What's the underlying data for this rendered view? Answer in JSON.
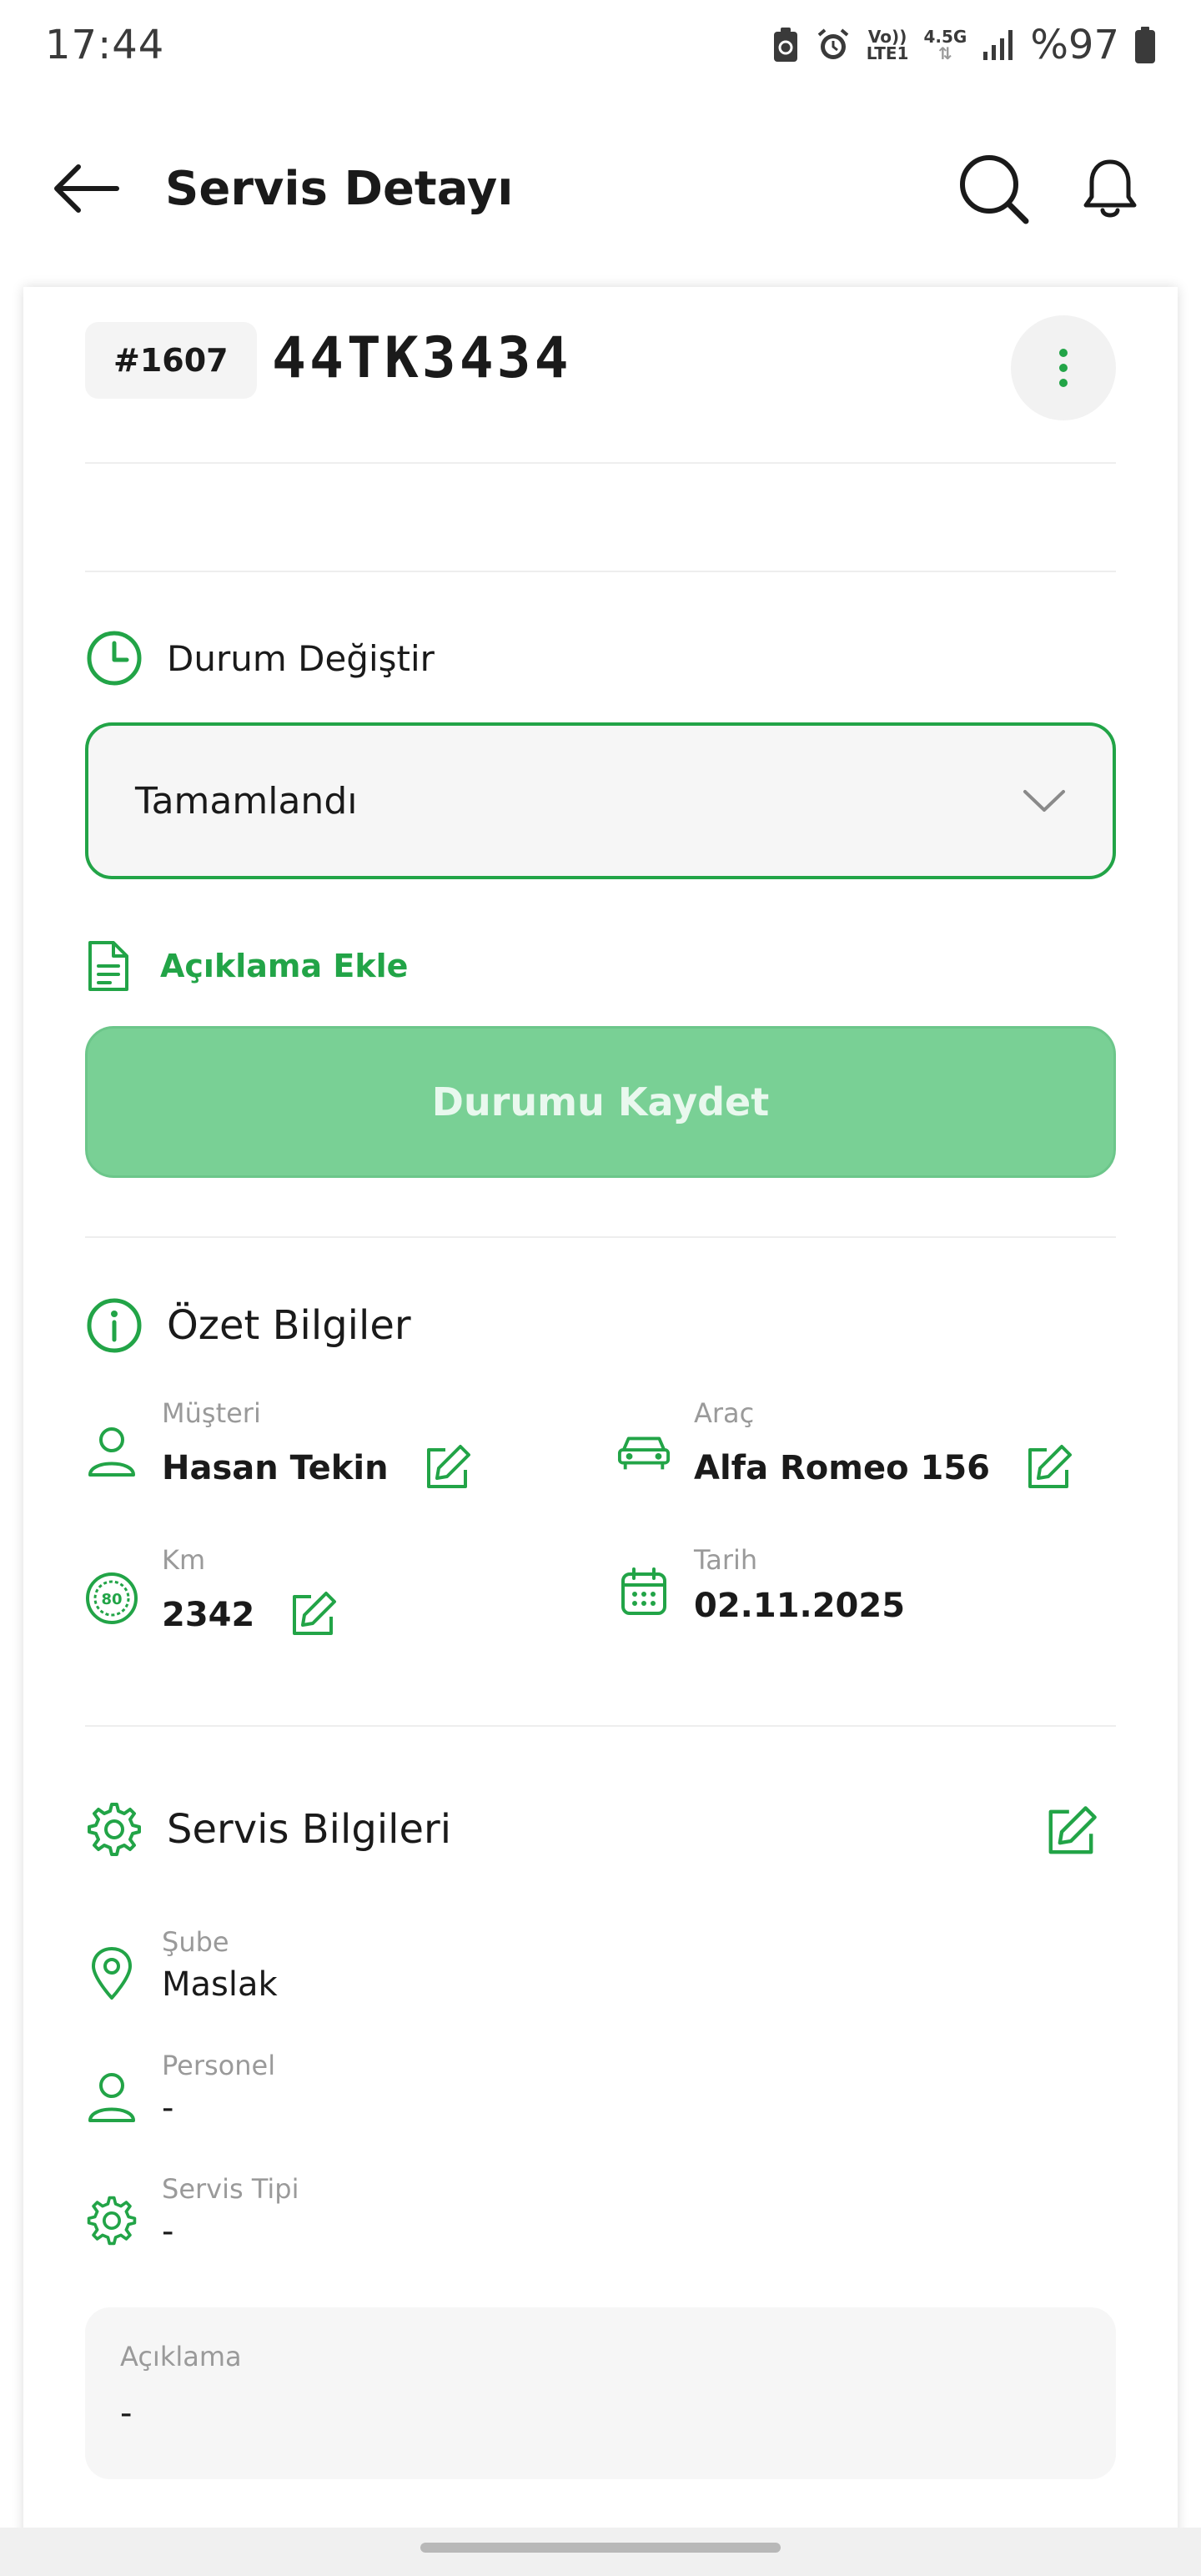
{
  "status_bar": {
    "time": "17:44",
    "volte_top": "Vo))",
    "volte_bottom": "LTE1",
    "network": "4.5G",
    "battery": "%97",
    "icons": [
      "battery-saver-icon",
      "alarm-icon",
      "signal-icon",
      "battery-icon"
    ]
  },
  "app_bar": {
    "title": "Servis Detayı",
    "icons": [
      "back-arrow-icon",
      "search-icon",
      "bell-icon"
    ]
  },
  "header": {
    "id_label": "#1607",
    "plate": "44TK3434"
  },
  "status_section": {
    "title": "Durum Değiştir",
    "selected_value": "Tamamlandı",
    "add_note_label": "Açıklama Ekle",
    "save_label": "Durumu Kaydet"
  },
  "summary": {
    "title": "Özet Bilgiler",
    "customer_label": "Müşteri",
    "customer_value": "Hasan Tekin",
    "vehicle_label": "Araç",
    "vehicle_value": "Alfa Romeo 156",
    "km_label": "Km",
    "km_value": "2342",
    "date_label": "Tarih",
    "date_value": "02.11.2025"
  },
  "service_info": {
    "title": "Servis Bilgileri",
    "branch_label": "Şube",
    "branch_value": "Maslak",
    "staff_label": "Personel",
    "staff_value": "-",
    "type_label": "Servis Tipi",
    "type_value": "-",
    "note_label": "Açıklama",
    "note_value": "-"
  },
  "colors": {
    "accent": "#22a447",
    "save_button": "#79d095",
    "chip_bg": "#f4f4f4"
  }
}
